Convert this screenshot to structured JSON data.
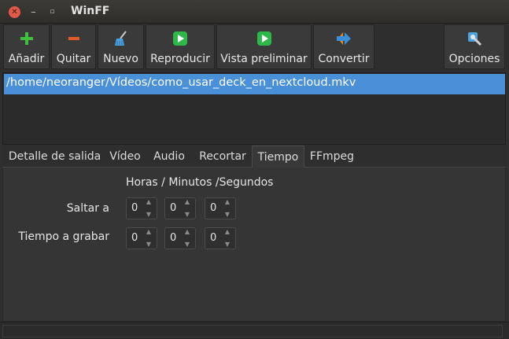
{
  "window": {
    "title": "WinFF"
  },
  "toolbar": {
    "buttons": [
      {
        "label": "Añadir",
        "icon": "plus-icon",
        "color": "#3fbf3f"
      },
      {
        "label": "Quitar",
        "icon": "minus-icon",
        "color": "#e05a2a"
      },
      {
        "label": "Nuevo",
        "icon": "broom-icon",
        "color": "#4aa3df"
      },
      {
        "label": "Reproducir",
        "icon": "play-icon",
        "color": "#2fb84a"
      },
      {
        "label": "Vista preliminar",
        "icon": "preview-icon",
        "color": "#2fb84a"
      },
      {
        "label": "Convertir",
        "icon": "convert-icon",
        "color": "#3a8fd8"
      },
      {
        "label": "Opciones",
        "icon": "settings-icon",
        "color": "#4aa3df"
      }
    ]
  },
  "filelist": {
    "items": [
      "/home/neoranger/Vídeos/como_usar_deck_en_nextcloud.mkv"
    ]
  },
  "tabs": [
    "Detalle de salida",
    "Vídeo",
    "Audio",
    "Recortar",
    "Tiempo",
    "FFmpeg"
  ],
  "active_tab": "Tiempo",
  "time": {
    "header": "Horas / Minutos /Segundos",
    "seek_label": "Saltar a",
    "record_label": "Tiempo a grabar",
    "seek": [
      "0",
      "0",
      "0"
    ],
    "record": [
      "0",
      "0",
      "0"
    ]
  },
  "colors": {
    "selection": "#4a90d9",
    "close_button": "#e2594a"
  }
}
